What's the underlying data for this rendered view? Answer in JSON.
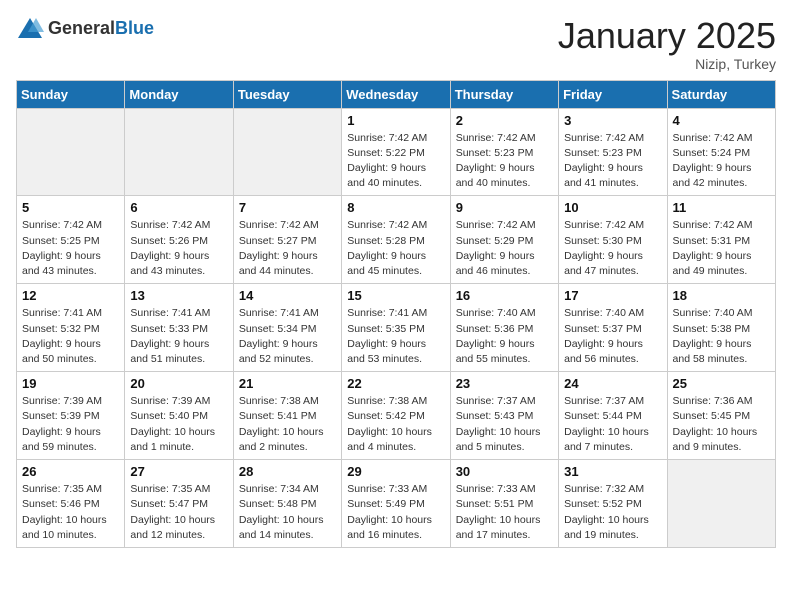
{
  "header": {
    "logo_general": "General",
    "logo_blue": "Blue",
    "month_title": "January 2025",
    "location": "Nizip, Turkey"
  },
  "weekdays": [
    "Sunday",
    "Monday",
    "Tuesday",
    "Wednesday",
    "Thursday",
    "Friday",
    "Saturday"
  ],
  "weeks": [
    [
      {
        "day": "",
        "info": ""
      },
      {
        "day": "",
        "info": ""
      },
      {
        "day": "",
        "info": ""
      },
      {
        "day": "1",
        "info": "Sunrise: 7:42 AM\nSunset: 5:22 PM\nDaylight: 9 hours\nand 40 minutes."
      },
      {
        "day": "2",
        "info": "Sunrise: 7:42 AM\nSunset: 5:23 PM\nDaylight: 9 hours\nand 40 minutes."
      },
      {
        "day": "3",
        "info": "Sunrise: 7:42 AM\nSunset: 5:23 PM\nDaylight: 9 hours\nand 41 minutes."
      },
      {
        "day": "4",
        "info": "Sunrise: 7:42 AM\nSunset: 5:24 PM\nDaylight: 9 hours\nand 42 minutes."
      }
    ],
    [
      {
        "day": "5",
        "info": "Sunrise: 7:42 AM\nSunset: 5:25 PM\nDaylight: 9 hours\nand 43 minutes."
      },
      {
        "day": "6",
        "info": "Sunrise: 7:42 AM\nSunset: 5:26 PM\nDaylight: 9 hours\nand 43 minutes."
      },
      {
        "day": "7",
        "info": "Sunrise: 7:42 AM\nSunset: 5:27 PM\nDaylight: 9 hours\nand 44 minutes."
      },
      {
        "day": "8",
        "info": "Sunrise: 7:42 AM\nSunset: 5:28 PM\nDaylight: 9 hours\nand 45 minutes."
      },
      {
        "day": "9",
        "info": "Sunrise: 7:42 AM\nSunset: 5:29 PM\nDaylight: 9 hours\nand 46 minutes."
      },
      {
        "day": "10",
        "info": "Sunrise: 7:42 AM\nSunset: 5:30 PM\nDaylight: 9 hours\nand 47 minutes."
      },
      {
        "day": "11",
        "info": "Sunrise: 7:42 AM\nSunset: 5:31 PM\nDaylight: 9 hours\nand 49 minutes."
      }
    ],
    [
      {
        "day": "12",
        "info": "Sunrise: 7:41 AM\nSunset: 5:32 PM\nDaylight: 9 hours\nand 50 minutes."
      },
      {
        "day": "13",
        "info": "Sunrise: 7:41 AM\nSunset: 5:33 PM\nDaylight: 9 hours\nand 51 minutes."
      },
      {
        "day": "14",
        "info": "Sunrise: 7:41 AM\nSunset: 5:34 PM\nDaylight: 9 hours\nand 52 minutes."
      },
      {
        "day": "15",
        "info": "Sunrise: 7:41 AM\nSunset: 5:35 PM\nDaylight: 9 hours\nand 53 minutes."
      },
      {
        "day": "16",
        "info": "Sunrise: 7:40 AM\nSunset: 5:36 PM\nDaylight: 9 hours\nand 55 minutes."
      },
      {
        "day": "17",
        "info": "Sunrise: 7:40 AM\nSunset: 5:37 PM\nDaylight: 9 hours\nand 56 minutes."
      },
      {
        "day": "18",
        "info": "Sunrise: 7:40 AM\nSunset: 5:38 PM\nDaylight: 9 hours\nand 58 minutes."
      }
    ],
    [
      {
        "day": "19",
        "info": "Sunrise: 7:39 AM\nSunset: 5:39 PM\nDaylight: 9 hours\nand 59 minutes."
      },
      {
        "day": "20",
        "info": "Sunrise: 7:39 AM\nSunset: 5:40 PM\nDaylight: 10 hours\nand 1 minute."
      },
      {
        "day": "21",
        "info": "Sunrise: 7:38 AM\nSunset: 5:41 PM\nDaylight: 10 hours\nand 2 minutes."
      },
      {
        "day": "22",
        "info": "Sunrise: 7:38 AM\nSunset: 5:42 PM\nDaylight: 10 hours\nand 4 minutes."
      },
      {
        "day": "23",
        "info": "Sunrise: 7:37 AM\nSunset: 5:43 PM\nDaylight: 10 hours\nand 5 minutes."
      },
      {
        "day": "24",
        "info": "Sunrise: 7:37 AM\nSunset: 5:44 PM\nDaylight: 10 hours\nand 7 minutes."
      },
      {
        "day": "25",
        "info": "Sunrise: 7:36 AM\nSunset: 5:45 PM\nDaylight: 10 hours\nand 9 minutes."
      }
    ],
    [
      {
        "day": "26",
        "info": "Sunrise: 7:35 AM\nSunset: 5:46 PM\nDaylight: 10 hours\nand 10 minutes."
      },
      {
        "day": "27",
        "info": "Sunrise: 7:35 AM\nSunset: 5:47 PM\nDaylight: 10 hours\nand 12 minutes."
      },
      {
        "day": "28",
        "info": "Sunrise: 7:34 AM\nSunset: 5:48 PM\nDaylight: 10 hours\nand 14 minutes."
      },
      {
        "day": "29",
        "info": "Sunrise: 7:33 AM\nSunset: 5:49 PM\nDaylight: 10 hours\nand 16 minutes."
      },
      {
        "day": "30",
        "info": "Sunrise: 7:33 AM\nSunset: 5:51 PM\nDaylight: 10 hours\nand 17 minutes."
      },
      {
        "day": "31",
        "info": "Sunrise: 7:32 AM\nSunset: 5:52 PM\nDaylight: 10 hours\nand 19 minutes."
      },
      {
        "day": "",
        "info": ""
      }
    ]
  ]
}
